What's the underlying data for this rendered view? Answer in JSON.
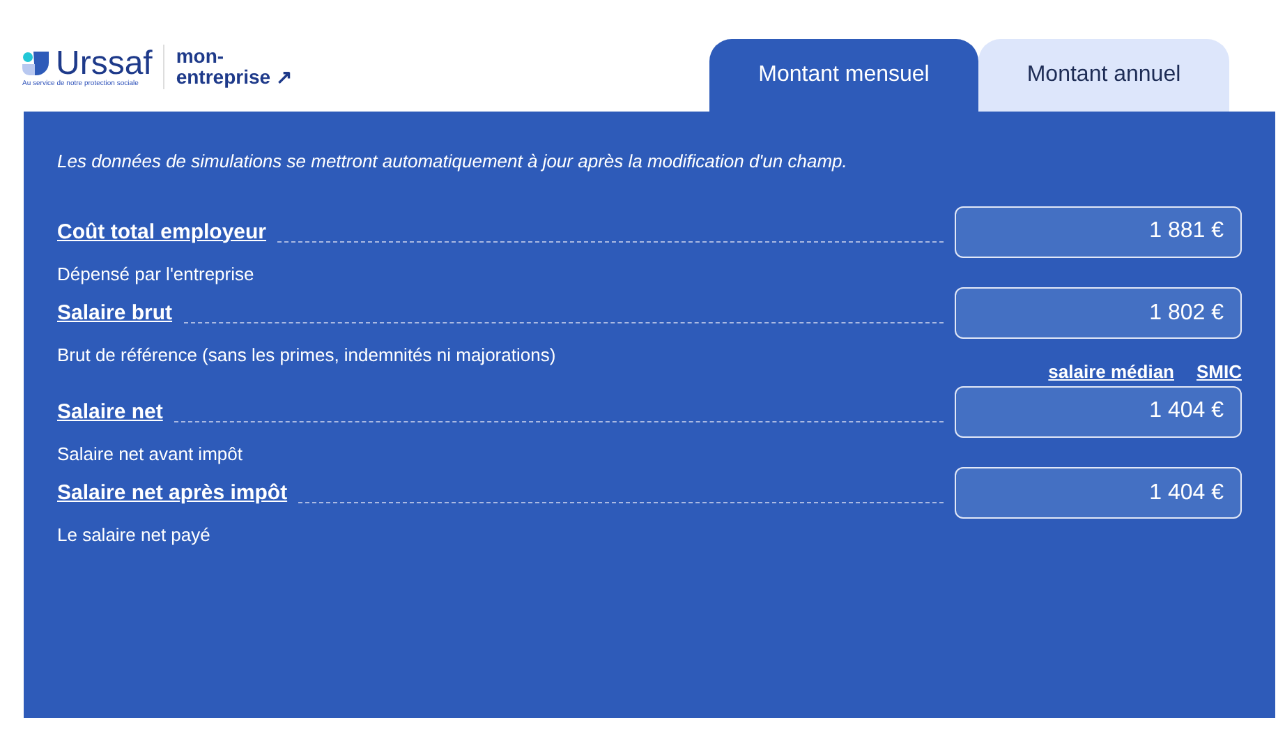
{
  "header": {
    "logo_name": "Urssaf",
    "logo_tagline": "Au service de notre protection sociale",
    "partner": "mon-entreprise",
    "partner_arrow": "↗"
  },
  "tabs": [
    {
      "label": "Montant mensuel",
      "selected": true
    },
    {
      "label": "Montant annuel",
      "selected": false
    }
  ],
  "note": "Les données de simulations se mettront automatiquement à jour après la modification d'un champ.",
  "rows": [
    {
      "label": "Coût total employeur",
      "description": "Dépensé par l'entreprise",
      "value": "1 881 €"
    },
    {
      "label": "Salaire brut",
      "description": "Brut de référence (sans les primes, indemnités ni majorations)",
      "value": "1 802 €",
      "links": [
        "salaire médian",
        "SMIC"
      ]
    },
    {
      "label": "Salaire net",
      "description": "Salaire net avant impôt",
      "value": "1 404 €"
    },
    {
      "label": "Salaire net après impôt",
      "description": "Le salaire net payé",
      "value": "1 404 €"
    }
  ]
}
